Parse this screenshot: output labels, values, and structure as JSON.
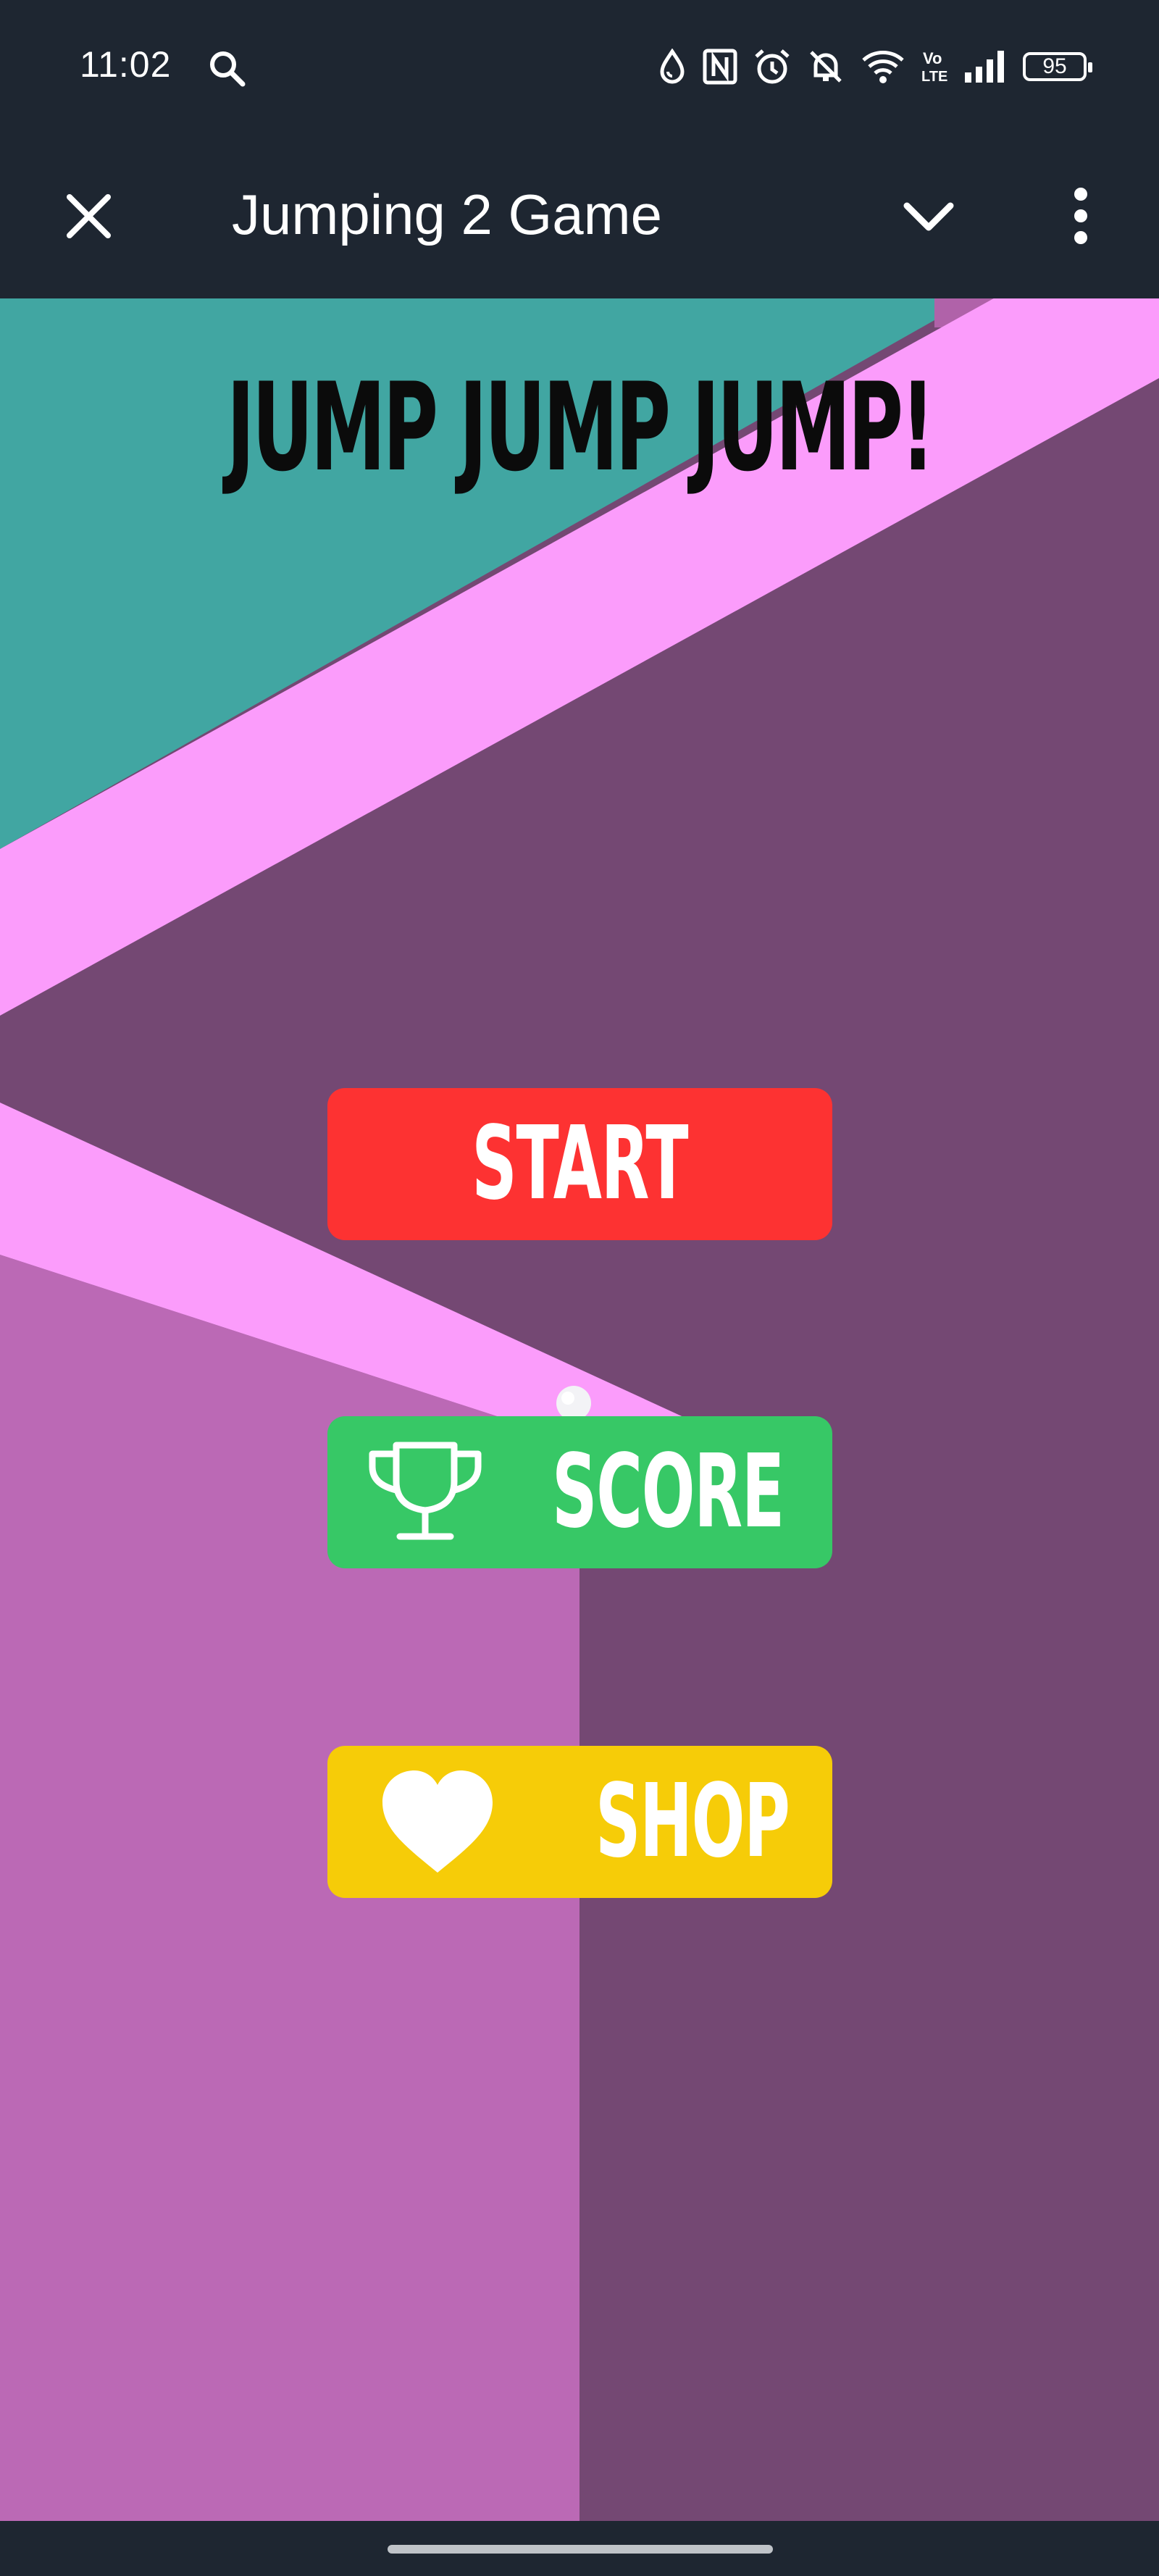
{
  "status_bar": {
    "time": "11:02",
    "battery": "95",
    "icons": [
      "search-icon",
      "data-saver-icon",
      "nfc-icon",
      "alarm-icon",
      "notifications-muted-icon",
      "wifi-icon",
      "volte-icon",
      "signal-icon",
      "battery-icon"
    ]
  },
  "app_bar": {
    "title": "Jumping 2 Game",
    "icons": [
      "close-icon",
      "chevron-down-icon",
      "more-vert-icon"
    ]
  },
  "game": {
    "title": "JUMP JUMP JUMP!",
    "buttons": {
      "start": "START",
      "score": "SCORE",
      "shop": "SHOP"
    },
    "colors": {
      "teal": "#41a6a2",
      "pink_path": "#fb9cfb",
      "dark_purple": "#744873",
      "mauve": "#bb69b5",
      "start": "#fd3232",
      "score": "#37c866",
      "shop": "#f6cc08"
    }
  }
}
